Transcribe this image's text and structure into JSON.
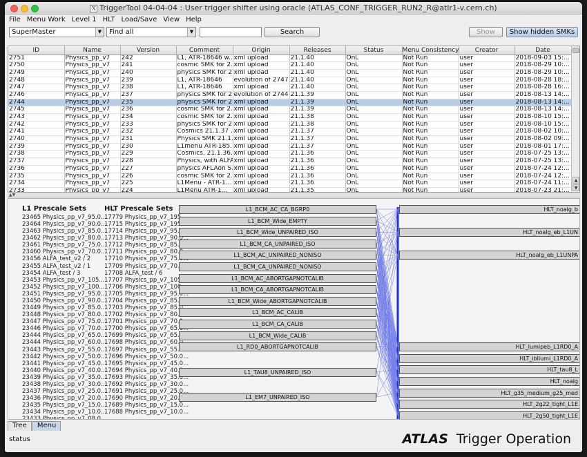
{
  "window": {
    "title": "TriggerTool 04-04-04 : User trigger shifter using oracle (ATLAS_CONF_TRIGGER_RUN2_R@atlr1-v.cern.ch)",
    "x_icon": "X"
  },
  "menu": [
    "File",
    "Menu Work",
    "Level 1",
    "HLT",
    "Load/Save",
    "View",
    "Help"
  ],
  "toolbar": {
    "type_select": "SuperMaster",
    "filter_select": "Find all",
    "search_value": "",
    "search_label": "Search",
    "show_label": "Show",
    "show_hidden_label": "Show hidden SMKs"
  },
  "table": {
    "columns": [
      "ID",
      "Name",
      "Version",
      "Comment",
      "Origin",
      "Releases",
      "Status",
      "Menu Consistency",
      "Creator",
      "Date"
    ],
    "selected_index": 6,
    "rows": [
      [
        "2751",
        "Physics_pp_v7",
        "242",
        "L1, ATR-18646 w...",
        "xml upload",
        "21.1.40",
        "OnL",
        "Not Run",
        "user",
        "2018-09-03 15:..."
      ],
      [
        "2750",
        "Physics_pp_v7",
        "241",
        "cosmic SMK for 2...",
        "xml upload",
        "21.1.40",
        "OnL",
        "Not Run",
        "user",
        "2018-08-29 10:..."
      ],
      [
        "2749",
        "Physics_pp_v7",
        "240",
        "physics SMK for 2...",
        "xml upload",
        "21.1.40",
        "OnL",
        "Not Run",
        "user",
        "2018-08-29 10:..."
      ],
      [
        "2748",
        "Physics_pp_v7",
        "239",
        "L1, ATR-18646",
        "evolution of 2747",
        "21.1.40",
        "OnL",
        "Not Run",
        "user",
        "2018-08-28 18:..."
      ],
      [
        "2747",
        "Physics_pp_v7",
        "238",
        "L1, ATR-18646",
        "xml upload",
        "21.1.40",
        "OnL",
        "Not Run",
        "user",
        "2018-08-28 16:..."
      ],
      [
        "2746",
        "Physics_pp_v7",
        "237",
        "physics SMK for 2...",
        "evolution of 2744",
        "21.1.39",
        "OnL",
        "Not Run",
        "user",
        "2018-08-13 14:..."
      ],
      [
        "2744",
        "Physics_pp_v7",
        "235",
        "physics SMK for 2...",
        "xml upload",
        "21.1.39",
        "OnL",
        "Not Run",
        "user",
        "2018-08-13 14:..."
      ],
      [
        "2745",
        "Physics_pp_v7",
        "236",
        "cosmic SMK for 2...",
        "xml upload",
        "21.1.39",
        "OnL",
        "Not Run",
        "user",
        "2018-08-13 14:..."
      ],
      [
        "2743",
        "Physics_pp_v7",
        "234",
        "cosmic SMK for 2...",
        "xml upload",
        "21.1.38",
        "OnL",
        "Not Run",
        "user",
        "2018-08-10 15:..."
      ],
      [
        "2742",
        "Physics_pp_v7",
        "233",
        "physics SMK for 2...",
        "xml upload",
        "21.1.38",
        "OnL",
        "Not Run",
        "user",
        "2018-08-10 15:..."
      ],
      [
        "2741",
        "Physics_pp_v7",
        "232",
        "Cosmics 21.1.37 ...",
        "xml upload",
        "21.1.37",
        "OnL",
        "Not Run",
        "user",
        "2018-08-02 10:..."
      ],
      [
        "2740",
        "Physics_pp_v7",
        "231",
        "Physics SMK 21.1...",
        "xml upload",
        "21.1.37",
        "OnL",
        "Not Run",
        "user",
        "2018-08-02 09:..."
      ],
      [
        "2739",
        "Physics_pp_v7",
        "230",
        "L1menu ATR-185...",
        "xml upload",
        "21.1.37",
        "OnL",
        "Not Run",
        "user",
        "2018-08-01 17:..."
      ],
      [
        "2738",
        "Physics_pp_v7",
        "229",
        "Cosmics, 21.1.36...",
        "xml upload",
        "21.1.36",
        "OnL",
        "Not Run",
        "user",
        "2018-07-25 13:..."
      ],
      [
        "2737",
        "Physics_pp_v7",
        "228",
        "Physics, with ALFA...",
        "xml upload",
        "21.1.36",
        "OnL",
        "Not Run",
        "user",
        "2018-07-25 13:..."
      ],
      [
        "2736",
        "Physics_pp_v7",
        "227",
        "physics AFLAon S...",
        "xml upload",
        "21.1.36",
        "OnL",
        "Not Run",
        "user",
        "2018-07-24 12:..."
      ],
      [
        "2735",
        "Physics_pp_v7",
        "226",
        "cosmic SMK for 2...",
        "xml upload",
        "21.1.36",
        "OnL",
        "Not Run",
        "user",
        "2018-07-24 12:..."
      ],
      [
        "2734",
        "Physics_pp_v7",
        "225",
        "L1Menu - ATR-1...",
        "xml upload",
        "21.1.36",
        "OnL",
        "Not Run",
        "user",
        "2018-07-24 11:..."
      ],
      [
        "2733",
        "Physics_pp_v7",
        "224",
        "L1Menu ATR-1...",
        "xml upload",
        "21.1.35",
        "OnL",
        "Not Run",
        "user",
        "2018-07-23 21:..."
      ]
    ]
  },
  "splitter_glyph": "▲▼",
  "lower": {
    "l1_title": "L1 Prescale Sets",
    "hlt_title": "HLT Prescale Sets",
    "l1_sets": [
      "23465 Physics_pp_v7_95.0...",
      "23464 Physics_pp_v7_90.0...",
      "23463 Physics_pp_v7_85.0...",
      "23462 Physics_pp_v7_80.0...",
      "23461 Physics_pp_v7_75.0...",
      "23460 Physics_pp_v7_70.0...",
      "23456 ALFA_test_v2 / 2",
      "23455 ALFA_test_v2 / 1",
      "23454 ALFA_test / 3",
      "23453 Physics_pp_v7_105...",
      "23452 Physics_pp_v7_100...",
      "23451 Physics_pp_v7_95.0...",
      "23450 Physics_pp_v7_90.0...",
      "23449 Physics_pp_v7_85.0...",
      "23448 Physics_pp_v7_80.0...",
      "23447 Physics_pp_v7_75.0...",
      "23446 Physics_pp_v7_70.0...",
      "23444 Physics_pp_v7_65.0...",
      "23444 Physics_pp_v7_60.0...",
      "23443 Physics_pp_v7_55.0...",
      "23442 Physics_pp_v7_50.0...",
      "23441 Physics_pp_v7_45.0...",
      "23440 Physics_pp_v7_40.0...",
      "23439 Physics_pp_v7_35.0...",
      "23438 Physics_pp_v7_30.0...",
      "23437 Physics_pp_v7_25.0...",
      "23436 Physics_pp_v7_20.0...",
      "23435 Physics_pp_v7_15.0...",
      "23434 Physics_pp_v7_10.0...",
      "23433 Physics_pp_v7_08.0..."
    ],
    "hlt_sets": [
      "17779 Physics_pp_v7_195...",
      "17715 Physics_pp_v7_195...",
      "17714 Physics_pp_v7_95.0...",
      "17713 Physics_pp_v7_90.0...",
      "17712 Physics_pp_v7_85.0...",
      "17711 Physics_pp_v7_80.0...",
      "17710 Physics_pp_v7_75.0...",
      "17709 Physics_pp_v7_70.0...",
      "17708 ALFA_test / 6",
      "17707 Physics_pp_v7_105...",
      "17706 Physics_pp_v7_100...",
      "17705 Physics_pp_v7_95.0...",
      "17704 Physics_pp_v7_85.0...",
      "17703 Physics_pp_v7_85.0...",
      "17702 Physics_pp_v7_80.0...",
      "17701 Physics_pp_v7_70.0...",
      "17700 Physics_pp_v7_65.0...",
      "17699 Physics_pp_v7_65.0...",
      "17698 Physics_pp_v7_60.0...",
      "17697 Physics_pp_v7_55.0...",
      "17696 Physics_pp_v7_50.0...",
      "17695 Physics_pp_v7_45.0...",
      "17694 Physics_pp_v7_40.0...",
      "17693 Physics_pp_v7_35.0...",
      "17692 Physics_pp_v7_30.0...",
      "17691 Physics_pp_v7_25.0...",
      "17690 Physics_pp_v7_20.0...",
      "17689 Physics_pp_v7_15.0...",
      "17688 Physics_pp_v7_10.0..."
    ],
    "l1_chains": [
      {
        "label": "L1_BCM_AC_CA_BGRP0",
        "slot": 0
      },
      {
        "label": "L1_BCM_Wide_EMPTY",
        "slot": 1
      },
      {
        "label": "L1_BCM_Wide_UNPAIRED_ISO",
        "slot": 2
      },
      {
        "label": "L1_BCM_CA_UNPAIRED_ISO",
        "slot": 3
      },
      {
        "label": "L1_BCM_AC_UNPAIRED_NONISO",
        "slot": 4
      },
      {
        "label": "L1_BCM_CA_UNPAIRED_NONISO",
        "slot": 5
      },
      {
        "label": "L1_BCM_AC_ABORTGAPNOTCALIB",
        "slot": 6
      },
      {
        "label": "L1_BCM_CA_ABORTGAPNOTCALIB",
        "slot": 7
      },
      {
        "label": "L1_BCM_Wide_ABORTGAPNOTCALIB",
        "slot": 8
      },
      {
        "label": "L1_BCM_AC_CALIB",
        "slot": 9
      },
      {
        "label": "L1_BCM_CA_CALIB",
        "slot": 10
      },
      {
        "label": "L1_BCM_Wide_CALIB",
        "slot": 11
      },
      {
        "label": "L1_RD0_ABORTGAPNOTCALIB",
        "slot": 12
      },
      {
        "label": "L1_TAU8_UNPAIRED_ISO",
        "slot": 14.2
      },
      {
        "label": "L1_EM7_UNPAIRED_ISO",
        "slot": 16.4
      }
    ],
    "hlt_chains": [
      {
        "label": "HLT_noalg_b",
        "slot": 0
      },
      {
        "label": "HLT_noalg_eb_L1UN",
        "slot": 2
      },
      {
        "label": "HLT_noalg_eb_L1UNPA",
        "slot": 4
      },
      {
        "label": "HLT_lumipeb_L1RD0_A",
        "slot": 12
      },
      {
        "label": "HLT_ibllumi_L1RD0_A",
        "slot": 13
      },
      {
        "label": "HLT_tau8_L",
        "slot": 14
      },
      {
        "label": "HLT_noalg",
        "slot": 15
      },
      {
        "label": "HLT_g35_medium_g25_med",
        "slot": 16
      },
      {
        "label": "HLT_2g22_tight_L1E",
        "slot": 17
      },
      {
        "label": "HLT_2g50_tight_L1E",
        "slot": 18
      }
    ]
  },
  "tabs": [
    {
      "label": "Tree",
      "active": false
    },
    {
      "label": "Menu",
      "active": true
    }
  ],
  "status": "status",
  "brand": {
    "atlas": "ATLAS",
    "subtitle": "Trigger Operation"
  }
}
